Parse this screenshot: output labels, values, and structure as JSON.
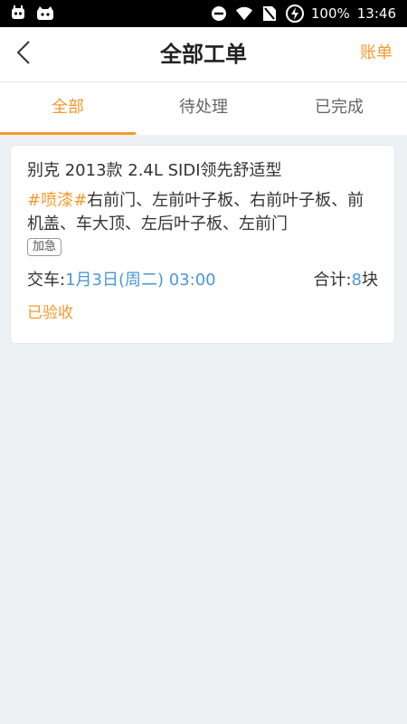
{
  "status_bar": {
    "battery_percent": "100%",
    "time": "13:46",
    "icons": [
      "android-bot-icon",
      "cat-app-icon",
      "do-not-disturb-icon",
      "wifi-icon",
      "no-sim-icon",
      "battery-icon"
    ]
  },
  "header": {
    "title": "全部工单",
    "action_label": "账单"
  },
  "tabs": [
    {
      "label": "全部",
      "active": true
    },
    {
      "label": "待处理",
      "active": false
    },
    {
      "label": "已完成",
      "active": false
    }
  ],
  "order": {
    "car_model": "别克 2013款 2.4L SIDI领先舒适型",
    "service_tag": "#喷漆#",
    "parts": "右前门、左前叶子板、右前叶子板、前机盖、车大顶、左后叶子板、左前门",
    "urgent_label": "加急",
    "delivery_label": "交车:",
    "delivery_time": "1月3日(周二) 03:00",
    "total_label": "合计:",
    "total_count": "8",
    "total_unit": "块",
    "status": "已验收"
  },
  "colors": {
    "accent": "#f39a2d",
    "link_blue": "#4a98d6",
    "background": "#eef1f4"
  }
}
